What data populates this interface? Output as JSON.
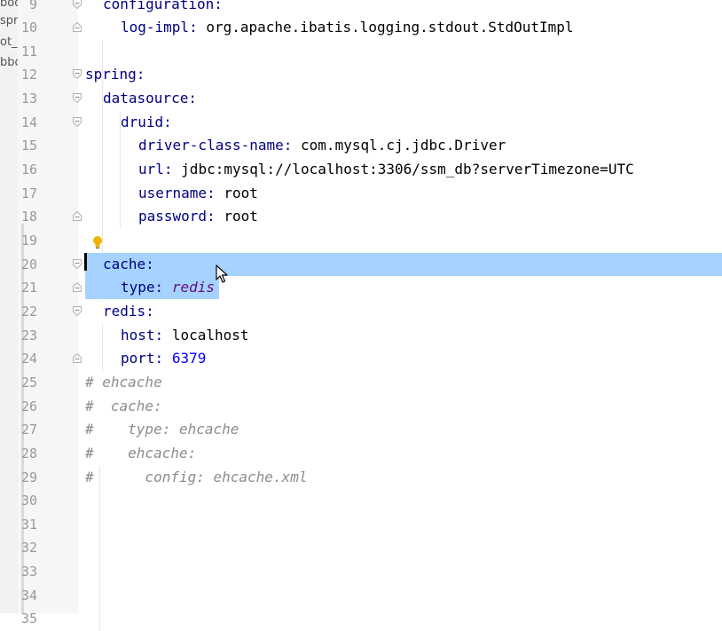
{
  "project_tree": {
    "fragments": [
      "boo",
      "spri",
      "ot_",
      "bbo"
    ]
  },
  "editor": {
    "lines": [
      {
        "num": "9",
        "indent": 1,
        "key": "configuration:",
        "value": "",
        "value_style": "",
        "fold": "open"
      },
      {
        "num": "10",
        "indent": 2,
        "key": "log-impl:",
        "value": "org.apache.ibatis.logging.stdout.StdOutImpl",
        "value_style": "plain",
        "fold": "close"
      },
      {
        "num": "11",
        "indent": 0,
        "key": "",
        "value": "",
        "value_style": "",
        "fold": ""
      },
      {
        "num": "12",
        "indent": 0,
        "key": "spring:",
        "value": "",
        "value_style": "",
        "fold": "open"
      },
      {
        "num": "13",
        "indent": 1,
        "key": "datasource:",
        "value": "",
        "value_style": "",
        "fold": "open"
      },
      {
        "num": "14",
        "indent": 2,
        "key": "druid:",
        "value": "",
        "value_style": "",
        "fold": "open"
      },
      {
        "num": "15",
        "indent": 3,
        "key": "driver-class-name:",
        "value": "com.mysql.cj.jdbc.Driver",
        "value_style": "plain",
        "fold": ""
      },
      {
        "num": "16",
        "indent": 3,
        "key": "url:",
        "value": "jdbc:mysql://localhost:3306/ssm_db?serverTimezone=UTC",
        "value_style": "plain",
        "fold": ""
      },
      {
        "num": "17",
        "indent": 3,
        "key": "username:",
        "value": "root",
        "value_style": "plain",
        "fold": ""
      },
      {
        "num": "18",
        "indent": 3,
        "key": "password:",
        "value": "root",
        "value_style": "plain",
        "fold": "close"
      },
      {
        "num": "19",
        "indent": 0,
        "key": "",
        "value": "",
        "value_style": "",
        "fold": ""
      },
      {
        "num": "20",
        "indent": 1,
        "key": "cache:",
        "value": "",
        "value_style": "",
        "fold": "open"
      },
      {
        "num": "21",
        "indent": 2,
        "key": "type:",
        "value": "redis",
        "value_style": "italic",
        "fold": "close"
      },
      {
        "num": "22",
        "indent": 1,
        "key": "redis:",
        "value": "",
        "value_style": "",
        "fold": "open"
      },
      {
        "num": "23",
        "indent": 2,
        "key": "host:",
        "value": "localhost",
        "value_style": "plain",
        "fold": ""
      },
      {
        "num": "24",
        "indent": 2,
        "key": "port:",
        "value": "6379",
        "value_style": "number",
        "fold": "close"
      },
      {
        "num": "25",
        "indent": 0,
        "comment": "# ehcache"
      },
      {
        "num": "26",
        "indent": 0,
        "comment": "#  cache:"
      },
      {
        "num": "27",
        "indent": 0,
        "comment": "#    type: ehcache"
      },
      {
        "num": "28",
        "indent": 0,
        "comment": "#    ehcache:"
      },
      {
        "num": "29",
        "indent": 0,
        "comment": "#      config: ehcache.xml"
      },
      {
        "num": "30",
        "indent": 0,
        "key": "",
        "value": "",
        "value_style": "",
        "fold": ""
      },
      {
        "num": "31",
        "indent": 0,
        "key": "",
        "value": "",
        "value_style": "",
        "fold": ""
      },
      {
        "num": "32",
        "indent": 0,
        "key": "",
        "value": "",
        "value_style": "",
        "fold": ""
      },
      {
        "num": "33",
        "indent": 0,
        "key": "",
        "value": "",
        "value_style": "",
        "fold": ""
      },
      {
        "num": "34",
        "indent": 0,
        "key": "",
        "value": "",
        "value_style": "",
        "fold": ""
      },
      {
        "num": "35",
        "indent": 0,
        "key": "",
        "value": "",
        "value_style": "",
        "fold": ""
      }
    ],
    "selection": {
      "full_line": "20",
      "partial_line": "21"
    },
    "colors": {
      "selection": "#a6d2ff",
      "key": "#000080",
      "number": "#0000ff",
      "comment": "#8c8c8c",
      "italic_value": "#660e7a",
      "bulb": "#f0b400"
    }
  }
}
